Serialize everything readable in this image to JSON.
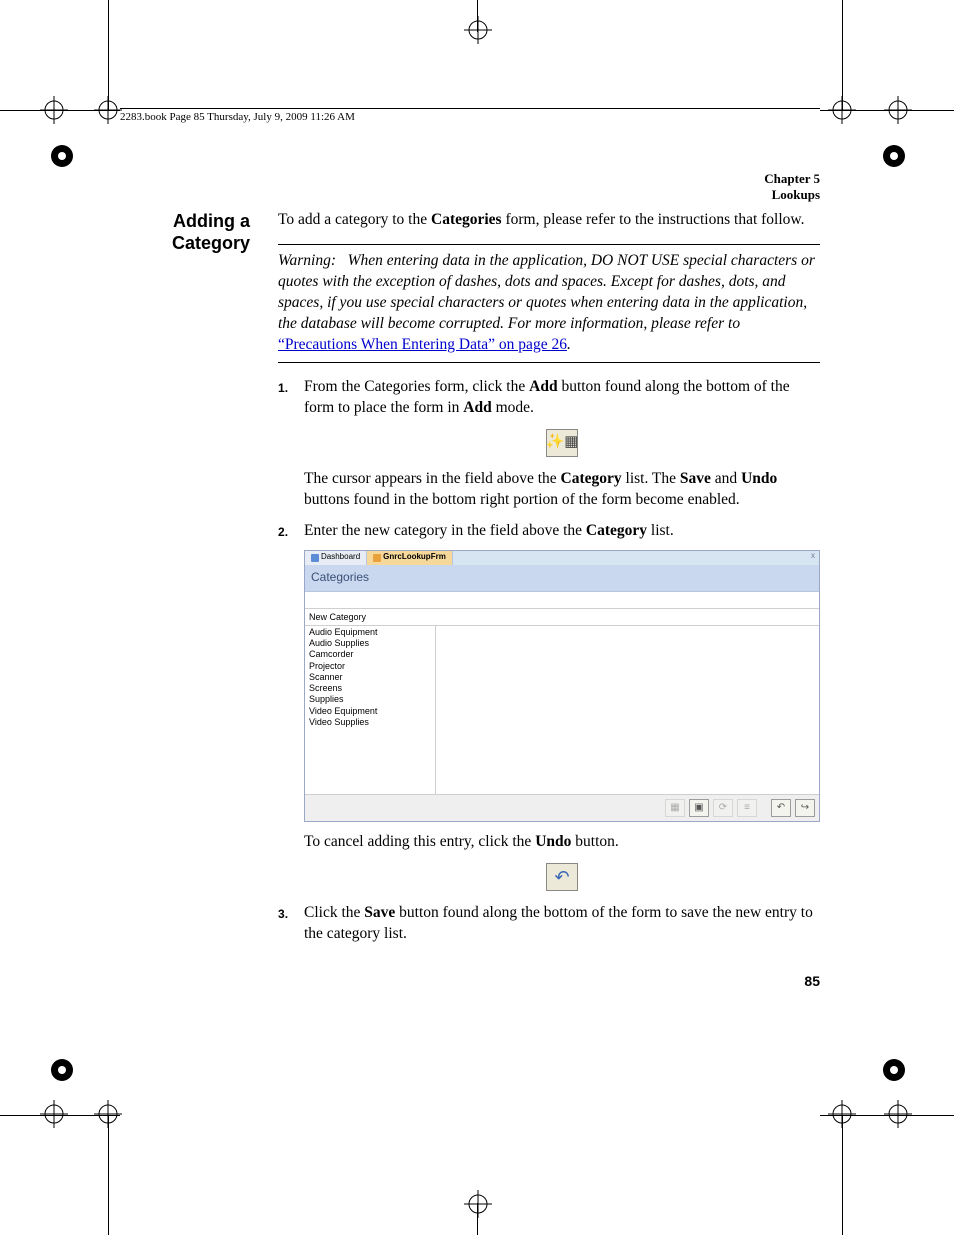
{
  "runningHead": "2283.book  Page 85  Thursday, July 9, 2009  11:26 AM",
  "chapterLine1": "Chapter 5",
  "chapterLine2": "Lookups",
  "sideHeading": "Adding a Category",
  "intro_before": "To add a category to the ",
  "intro_bold": "Categories",
  "intro_after": " form, please refer to the instructions that follow.",
  "warning_label": "Warning:",
  "warning_body_before_link": "When entering data in the application, DO NOT USE special characters or quotes with the exception of dashes, dots and spaces. Except for dashes, dots, and spaces, if you use special characters or quotes when entering data in the application, the database will become corrupted. For more information, please refer to ",
  "warning_link": "“Precautions When Entering Data” on page 26",
  "warning_after_link": ".",
  "step1_a": "From the Categories form, click the ",
  "step1_bold1": "Add",
  "step1_b": " button found along the bottom of the form to place the form in ",
  "step1_bold2": "Add",
  "step1_c": " mode.",
  "add_icon_glyph": "✨▦",
  "step1_follow_a": "The cursor appears in the field above the ",
  "step1_follow_b1": "Category",
  "step1_follow_b": " list. The ",
  "step1_follow_b2": "Save",
  "step1_follow_c": " and ",
  "step1_follow_b3": "Undo",
  "step1_follow_d": " buttons found in the bottom right portion of the form become enabled.",
  "step2_a": "Enter the new category in the field above the ",
  "step2_bold": "Category",
  "step2_b": " list.",
  "shot": {
    "tabs": {
      "dashboard": "Dashboard",
      "form": "GnrcLookupFrm"
    },
    "title": "Categories",
    "input_value": "New Category",
    "items": [
      "Audio Equipment",
      "Audio Supplies",
      "Camcorder",
      "Projector",
      "Scanner",
      "Screens",
      "Supplies",
      "Video Equipment",
      "Video Supplies"
    ],
    "close_glyph": "x",
    "btn_add": "▦",
    "btn_save": "▣",
    "btn_refresh": "⟳",
    "btn_list": "≡",
    "btn_undo": "↶",
    "btn_exit": "↪"
  },
  "cancel_a": "To cancel adding this entry, click the ",
  "cancel_bold": "Undo",
  "cancel_b": " button.",
  "undo_icon_glyph": "↶",
  "step3_a": "Click the ",
  "step3_bold": "Save",
  "step3_b": " button found along the bottom of the form to save the new entry to the category list.",
  "pageNum": "85"
}
